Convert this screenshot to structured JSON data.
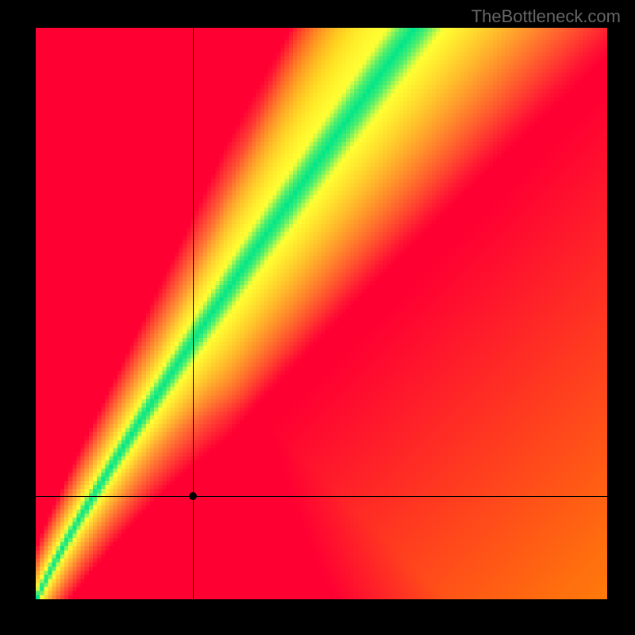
{
  "watermark": "TheBottleneck.com",
  "chart_data": {
    "type": "heatmap",
    "title": "",
    "xlabel": "",
    "ylabel": "",
    "xlim": [
      0,
      1
    ],
    "ylim": [
      0,
      1
    ],
    "marker": {
      "x": 0.275,
      "y": 0.18
    },
    "crosshair": {
      "x": 0.275,
      "y": 0.18
    },
    "ridge_description": "Green optimal band runs diagonally from lower-left to upper-right with slope ~1.8, narrowing toward origin",
    "color_scale_low": "#ff0033",
    "color_scale_mid_warm": "#ff9900",
    "color_scale_mid": "#ffff33",
    "color_scale_optimal": "#00e68a",
    "grid_resolution": 140
  }
}
